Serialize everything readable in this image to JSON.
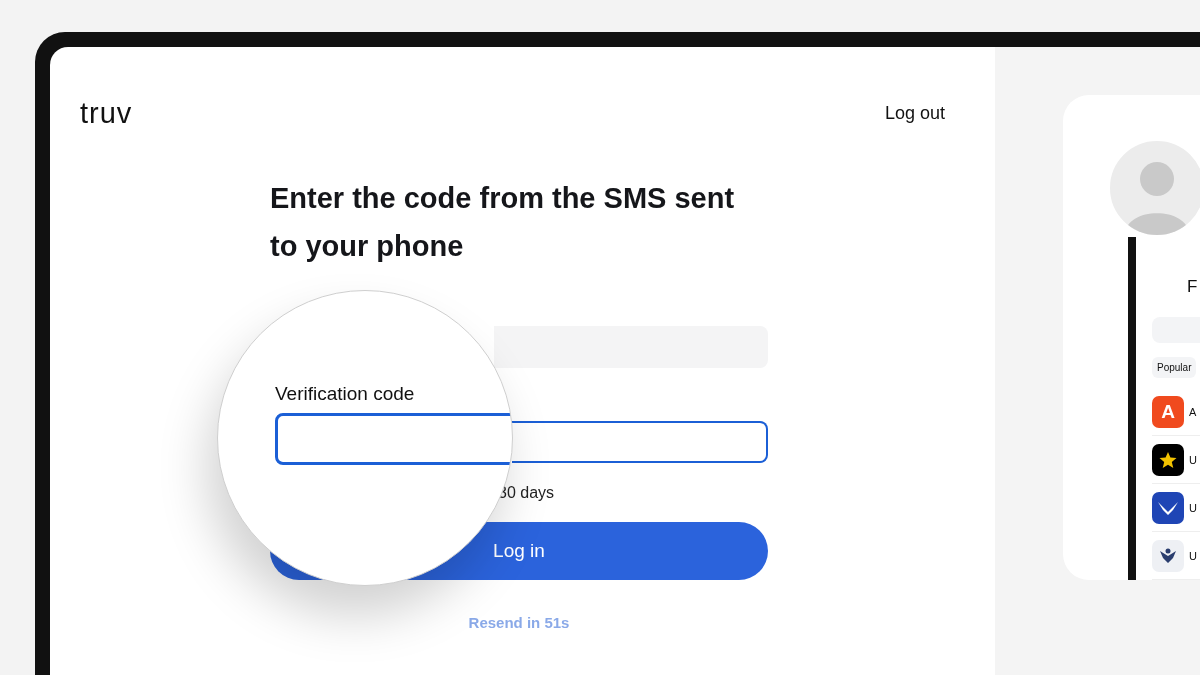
{
  "logo": "truv",
  "logout": "Log out",
  "heading": "Enter the code from the SMS sent to your phone",
  "phone_field": {
    "disabled": true
  },
  "code_field": {
    "focused": true
  },
  "remember_text": "30 days",
  "login_button": "Log in",
  "resend": "Resend in 51s",
  "magnifier": {
    "label": "Verification code",
    "focused": true
  },
  "phone_preview": {
    "title": "F",
    "chip": "Popular",
    "items": [
      {
        "kind": "letter",
        "letter": "A",
        "label": "A",
        "color": "#f04a1e"
      },
      {
        "kind": "star",
        "label": "U",
        "color": "#000000"
      },
      {
        "kind": "wings",
        "label": "U",
        "color": "#1f45b5"
      },
      {
        "kind": "emblem",
        "label": "U",
        "color": "#eef0f4"
      }
    ]
  }
}
